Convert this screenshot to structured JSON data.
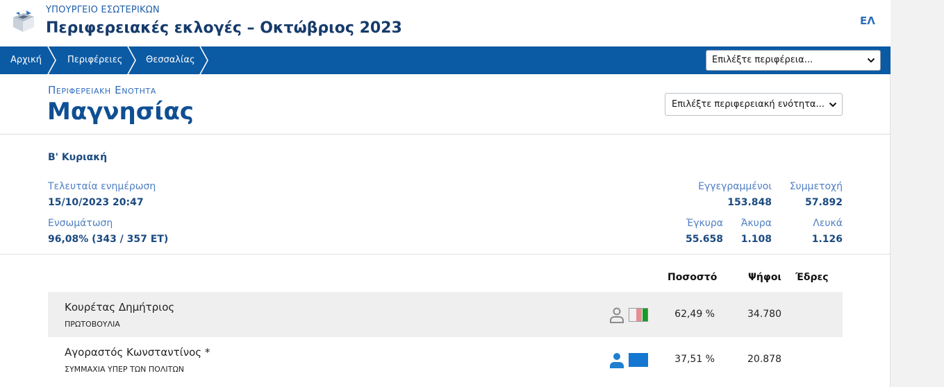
{
  "header": {
    "ministry": "ΥΠΟΥΡΓΕΙΟ ΕΣΩΤΕΡΙΚΩΝ",
    "title": "Περιφερειακές εκλογές – Οκτώβριος 2023",
    "language": "ΕΛ",
    "logo_icon": "ballot-box-icon"
  },
  "nav": {
    "breadcrumbs": [
      "Αρχική",
      "Περιφέρειες",
      "Θεσσαλίας"
    ],
    "region_select": "Επιλέξτε περιφέρεια..."
  },
  "unit": {
    "label": "Περιφερειακη Ενοτητα",
    "name": "Μαγνησίας",
    "select": "Επιλέξτε περιφερειακή ενότητα..."
  },
  "stats": {
    "round": "Β' Κυριακή",
    "last_update_label": "Τελευταία ενημέρωση",
    "last_update_value": "15/10/2023 20:47",
    "integration_label": "Ενσωμάτωση",
    "integration_value": "96,08% (343 / 357 ΕΤ)",
    "registered_label": "Εγγεγραμμένοι",
    "registered_value": "153.848",
    "turnout_label": "Συμμετοχή",
    "turnout_value": "57.892",
    "valid_label": "Έγκυρα",
    "valid_value": "55.658",
    "invalid_label": "Άκυρα",
    "invalid_value": "1.108",
    "blank_label": "Λευκά",
    "blank_value": "1.126"
  },
  "table": {
    "headers": {
      "percent": "Ποσοστό",
      "votes": "Ψήφοι",
      "seats": "Έδρες"
    },
    "rows": [
      {
        "name": "Κουρέτας Δημήτριος",
        "party": "ΠΡΩΤΟΒΟΥΛΙΑ",
        "percent": "62,49 %",
        "votes": "34.780",
        "seats": "",
        "icon": "person-icon",
        "icon_color": "#8a8a8a",
        "colors": [
          "#f1f1f1",
          "#e58f95",
          "#1a9a27"
        ]
      },
      {
        "name": "Αγοραστός Κωνσταντίνος *",
        "party": "ΣΥΜΜΑΧΙΑ ΥΠΕΡ ΤΩΝ ΠΟΛΙΤΩΝ",
        "percent": "37,51 %",
        "votes": "20.878",
        "seats": "",
        "icon": "person-icon",
        "icon_color": "#1f7fd0",
        "colors": [
          "#1577d1"
        ]
      }
    ]
  },
  "colors": {
    "nav_bg": "#0b5aa4",
    "accent": "#0f4f93",
    "label": "#4f7fc2"
  }
}
